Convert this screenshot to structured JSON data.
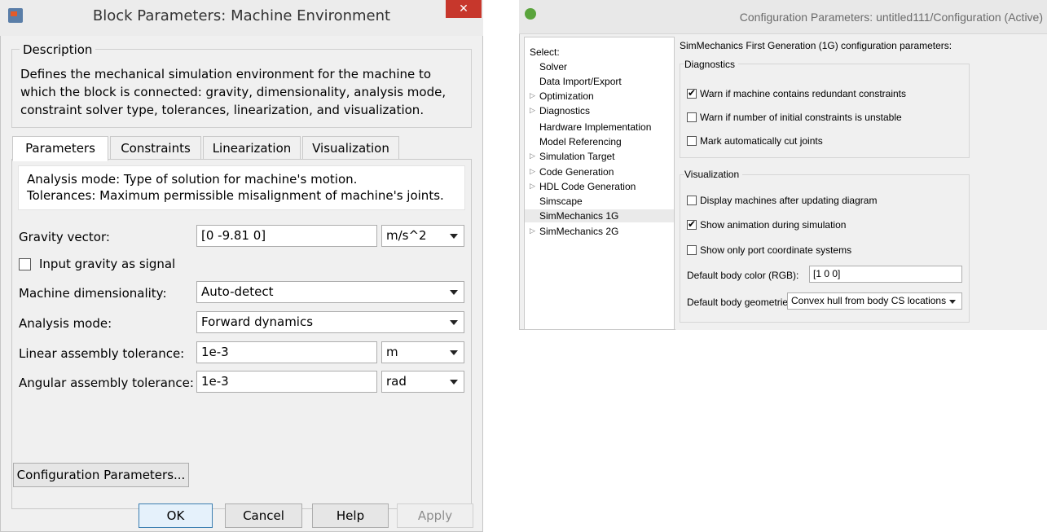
{
  "block_dialog": {
    "title": "Block Parameters: Machine Environment",
    "close_glyph": "✕",
    "description": {
      "legend": "Description",
      "text": "Defines the mechanical simulation environment for the machine to which the block is connected: gravity, dimensionality, analysis mode, constraint solver type, tolerances, linearization, and visualization."
    },
    "tabs": [
      {
        "label": "Parameters",
        "active": true
      },
      {
        "label": "Constraints",
        "active": false
      },
      {
        "label": "Linearization",
        "active": false
      },
      {
        "label": "Visualization",
        "active": false
      }
    ],
    "help_lines": [
      "Analysis mode: Type of solution for machine's motion.",
      "Tolerances: Maximum permissible misalignment of machine's joints."
    ],
    "gravity": {
      "label": "Gravity vector:",
      "value": "[0 -9.81 0]",
      "unit": "m/s^2"
    },
    "input_gravity": {
      "label": "Input gravity as signal",
      "checked": false
    },
    "dimensionality": {
      "label": "Machine dimensionality:",
      "value": "Auto-detect"
    },
    "analysis": {
      "label": "Analysis mode:",
      "value": "Forward dynamics"
    },
    "linear_tol": {
      "label": "Linear assembly tolerance:",
      "value": "1e-3",
      "unit": "m"
    },
    "angular_tol": {
      "label": "Angular assembly tolerance:",
      "value": "1e-3",
      "unit": "rad"
    },
    "buttons": {
      "config": "Configuration Parameters...",
      "ok": "OK",
      "cancel": "Cancel",
      "help": "Help",
      "apply": "Apply"
    }
  },
  "config_dialog": {
    "title": "Configuration Parameters: untitled111/Configuration (Active)",
    "select_label": "Select:",
    "tree": [
      {
        "label": "Solver",
        "expandable": false,
        "selected": false
      },
      {
        "label": "Data Import/Export",
        "expandable": false,
        "selected": false
      },
      {
        "label": "Optimization",
        "expandable": true,
        "selected": false
      },
      {
        "label": "Diagnostics",
        "expandable": true,
        "selected": false
      },
      {
        "label": "Hardware Implementation",
        "expandable": false,
        "selected": false
      },
      {
        "label": "Model Referencing",
        "expandable": false,
        "selected": false
      },
      {
        "label": "Simulation Target",
        "expandable": true,
        "selected": false
      },
      {
        "label": "Code Generation",
        "expandable": true,
        "selected": false
      },
      {
        "label": "HDL Code Generation",
        "expandable": true,
        "selected": false
      },
      {
        "label": "Simscape",
        "expandable": false,
        "selected": false
      },
      {
        "label": "SimMechanics 1G",
        "expandable": false,
        "selected": true
      },
      {
        "label": "SimMechanics 2G",
        "expandable": true,
        "selected": false
      }
    ],
    "tree_arrow_glyph": "▷",
    "heading": "SimMechanics First Generation (1G) configuration parameters:",
    "diagnostics": {
      "legend": "Diagnostics",
      "options": [
        {
          "label": "Warn if machine contains redundant constraints",
          "checked": true
        },
        {
          "label": "Warn if number of initial constraints is unstable",
          "checked": false
        },
        {
          "label": "Mark automatically cut joints",
          "checked": false
        }
      ]
    },
    "visualization": {
      "legend": "Visualization",
      "options": [
        {
          "label": "Display machines after updating diagram",
          "checked": false
        },
        {
          "label": "Show animation during simulation",
          "checked": true
        },
        {
          "label": "Show only port coordinate systems",
          "checked": false
        }
      ],
      "body_color": {
        "label": "Default body color (RGB):",
        "value": "[1 0 0]"
      },
      "body_geometry": {
        "label": "Default body geometries:",
        "value": "Convex hull from body CS locations"
      }
    },
    "check_glyph": "✔"
  }
}
